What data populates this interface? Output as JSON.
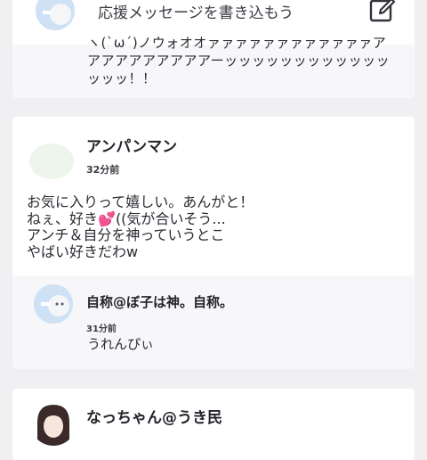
{
  "post_top": {
    "write_placeholder": "応援メッセージを書き込もう",
    "comment_text": "ヽ(`ω´)ノウォオオァァァァァァァァァァァァアアアアアアアアアアーッッッッッッッッッッッッッッッ！！"
  },
  "post_main": {
    "author": "アンパンマン",
    "time": "32分前",
    "body_lines": [
      "お気に入りって嬉しい。あんがと！",
      "ねぇ、好き",
      "((気が合いそう...",
      "アンチ＆自分を神っていうとこ",
      "やばい好きだわw"
    ],
    "reply": {
      "author": "自称@ぼ子は神。自称。",
      "time": "31分前",
      "text": "うれんぴぃ"
    }
  },
  "post_next": {
    "author": "なっちゃん@うき民"
  },
  "icons": {
    "edit": "edit-pencil-icon",
    "heart": "sparkling-hearts-emoji"
  },
  "colors": {
    "background": "#f0f0f2",
    "card": "#ffffff",
    "reply_bg": "#f7f7f9",
    "heart": "#e8339a"
  }
}
